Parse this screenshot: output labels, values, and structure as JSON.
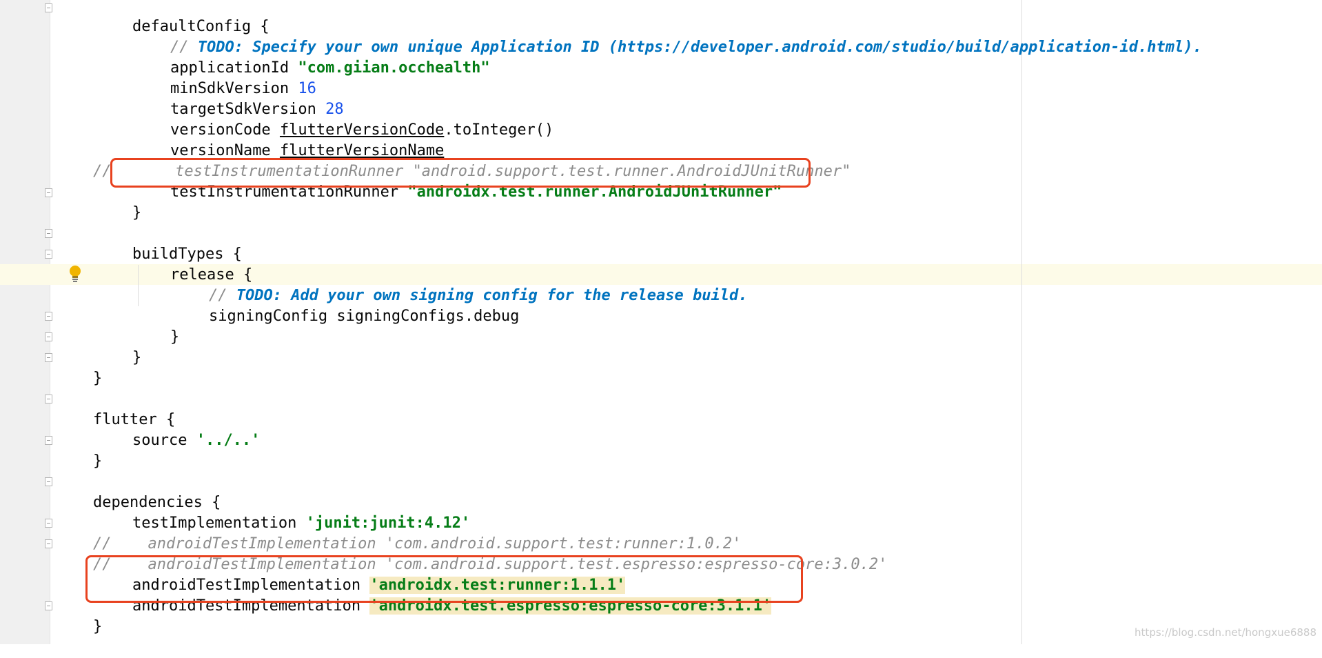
{
  "editor": {
    "lines": {
      "l1": {
        "text": "defaultConfig {"
      },
      "l2": {
        "comment": "// ",
        "todo": "TODO: Specify your own unique Application ID (https://developer.android.com/studio/build/application-id.html)."
      },
      "l3": {
        "key": "applicationId ",
        "value": "\"com.giian.occhealth\""
      },
      "l4": {
        "key": "minSdkVersion ",
        "value": "16"
      },
      "l5": {
        "key": "targetSdkVersion ",
        "value": "28"
      },
      "l6": {
        "key": "versionCode ",
        "var": "flutterVersionCode",
        "rest": ".toInteger()"
      },
      "l7": {
        "key": "versionName ",
        "var": "flutterVersionName"
      },
      "l8": {
        "text": "//       testInstrumentationRunner \"android.support.test.runner.AndroidJUnitRunner\""
      },
      "l9": {
        "key": "testInstrumentationRunner ",
        "value": "\"androidx.test.runner.AndroidJUnitRunner\""
      },
      "l10": {
        "text": "}"
      },
      "l11": {
        "text": "buildTypes {"
      },
      "l12": {
        "text": "release {"
      },
      "l13": {
        "comment": "// ",
        "todo": "TODO: Add your own signing config for the release build."
      },
      "l14": {
        "text": "signingConfig signingConfigs.debug"
      },
      "l15": {
        "text": "}"
      },
      "l16": {
        "text": "}"
      },
      "l17": {
        "text": "}"
      },
      "l18": {
        "text": "flutter {"
      },
      "l19": {
        "key": "source ",
        "value": "'../..'"
      },
      "l20": {
        "text": "}"
      },
      "l21": {
        "text": "dependencies {"
      },
      "l22": {
        "key": "testImplementation ",
        "value": "'junit:junit:4.12'"
      },
      "l23": {
        "text": "//    androidTestImplementation 'com.android.support.test:runner:1.0.2'"
      },
      "l24": {
        "text": "//    androidTestImplementation 'com.android.support.test.espresso:espresso-core:3.0.2'"
      },
      "l25": {
        "key": "androidTestImplementation ",
        "value": "'androidx.test:runner:1.1.1'"
      },
      "l26": {
        "key": "androidTestImplementation ",
        "value": "'androidx.test.espresso:espresso-core:3.1.1'"
      },
      "l27": {
        "text": "}"
      }
    }
  },
  "watermark": "https://blog.csdn.net/hongxue6888",
  "colors": {
    "annotation_box": "#e8421f",
    "string": "#067d17",
    "number": "#1750eb",
    "todo": "#0073bf",
    "comment": "#8c8c8c"
  },
  "icons": [
    "fold-icon",
    "intention-bulb-icon"
  ]
}
